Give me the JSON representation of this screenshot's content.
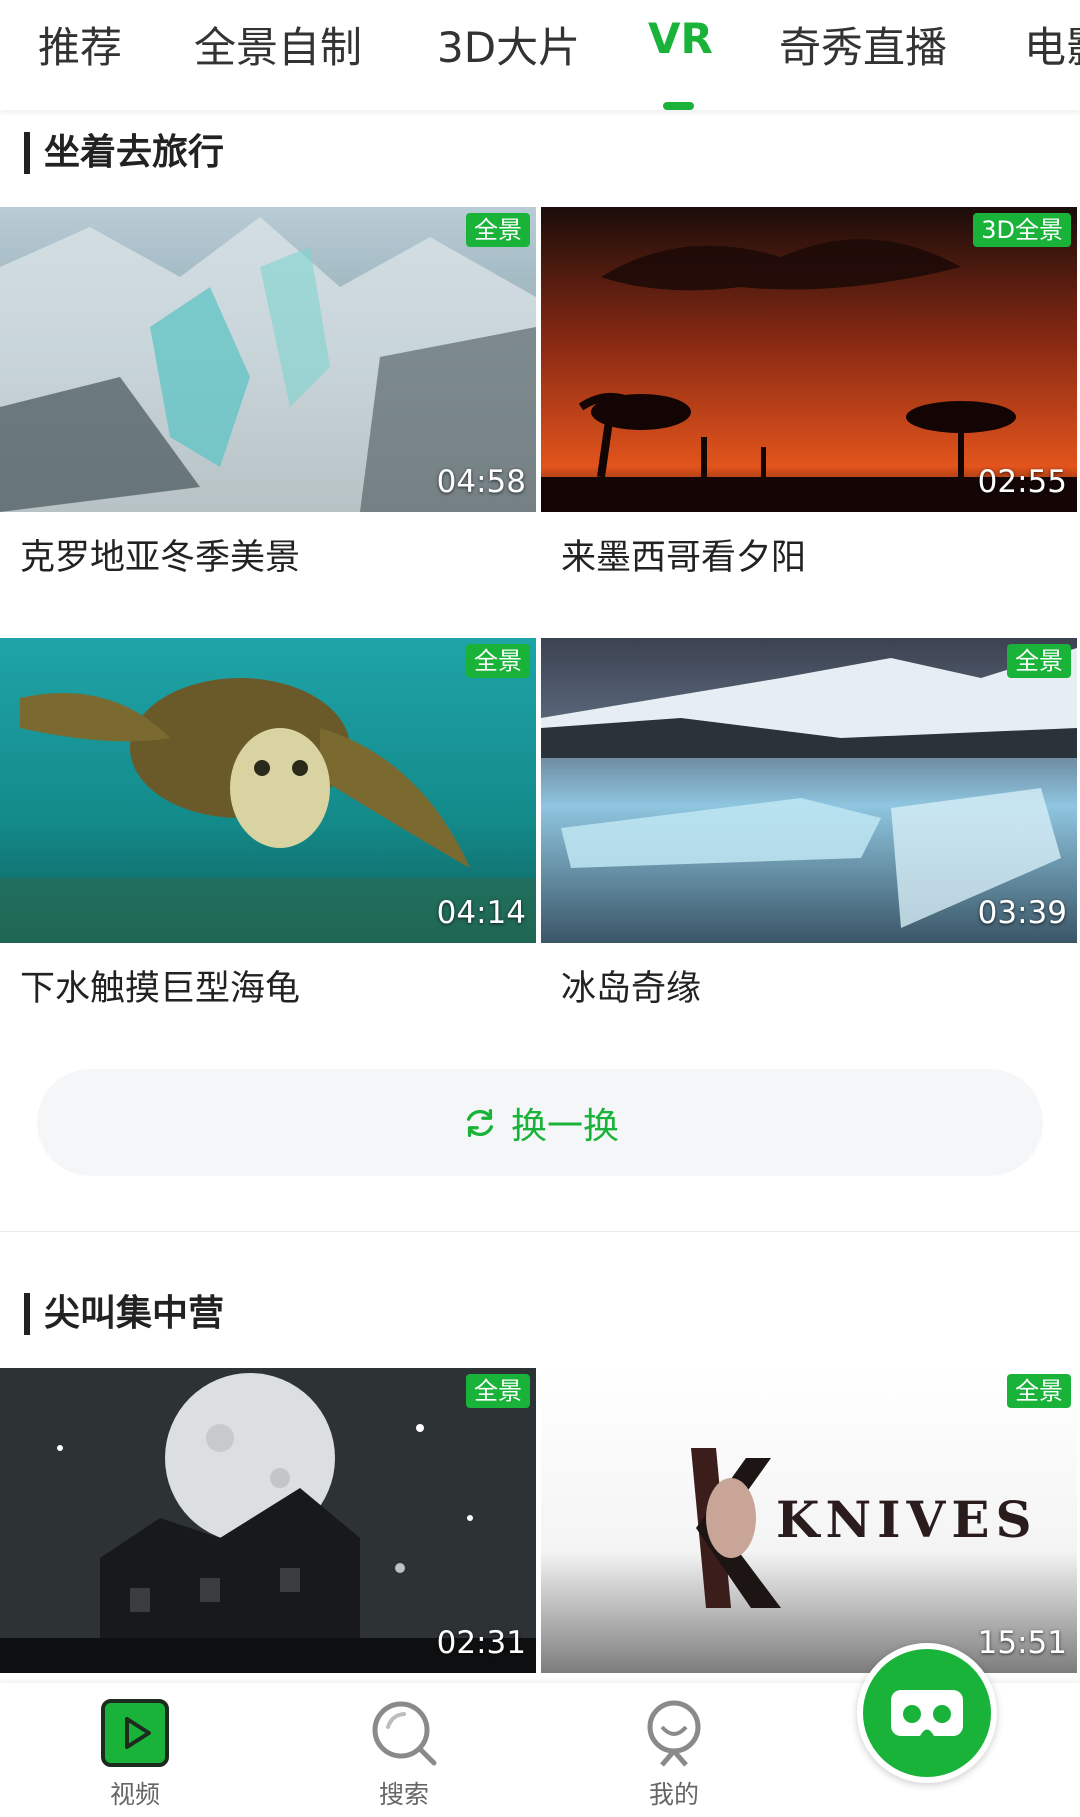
{
  "tabs": [
    {
      "label": "推荐"
    },
    {
      "label": "全景自制"
    },
    {
      "label": "3D大片"
    },
    {
      "label": "VR"
    },
    {
      "label": "奇秀直播"
    },
    {
      "label": "电影"
    }
  ],
  "active_tab": "VR",
  "sections": [
    {
      "title": "坐着去旅行",
      "cards": [
        {
          "title": "克罗地亚冬季美景",
          "badge": "全景",
          "duration": "04:58"
        },
        {
          "title": "来墨西哥看夕阳",
          "badge": "3D全景",
          "duration": "02:55"
        },
        {
          "title": "下水触摸巨型海龟",
          "badge": "全景",
          "duration": "04:14"
        },
        {
          "title": "冰岛奇缘",
          "badge": "全景",
          "duration": "03:39"
        }
      ],
      "refresh_label": "换一换"
    },
    {
      "title": "尖叫集中营",
      "cards": [
        {
          "badge": "全景",
          "duration": "02:31",
          "poster_text": ""
        },
        {
          "badge": "全景",
          "duration": "15:51",
          "poster_text": "KNIVES"
        }
      ]
    }
  ],
  "bottom_nav": [
    {
      "label": "视频",
      "icon": "video-play-icon"
    },
    {
      "label": "搜索",
      "icon": "search-icon"
    },
    {
      "label": "我的",
      "icon": "profile-icon"
    }
  ],
  "fab_icon": "vr-glasses-icon",
  "colors": {
    "accent": "#19b33a",
    "text": "#222222",
    "muted": "#666666"
  }
}
